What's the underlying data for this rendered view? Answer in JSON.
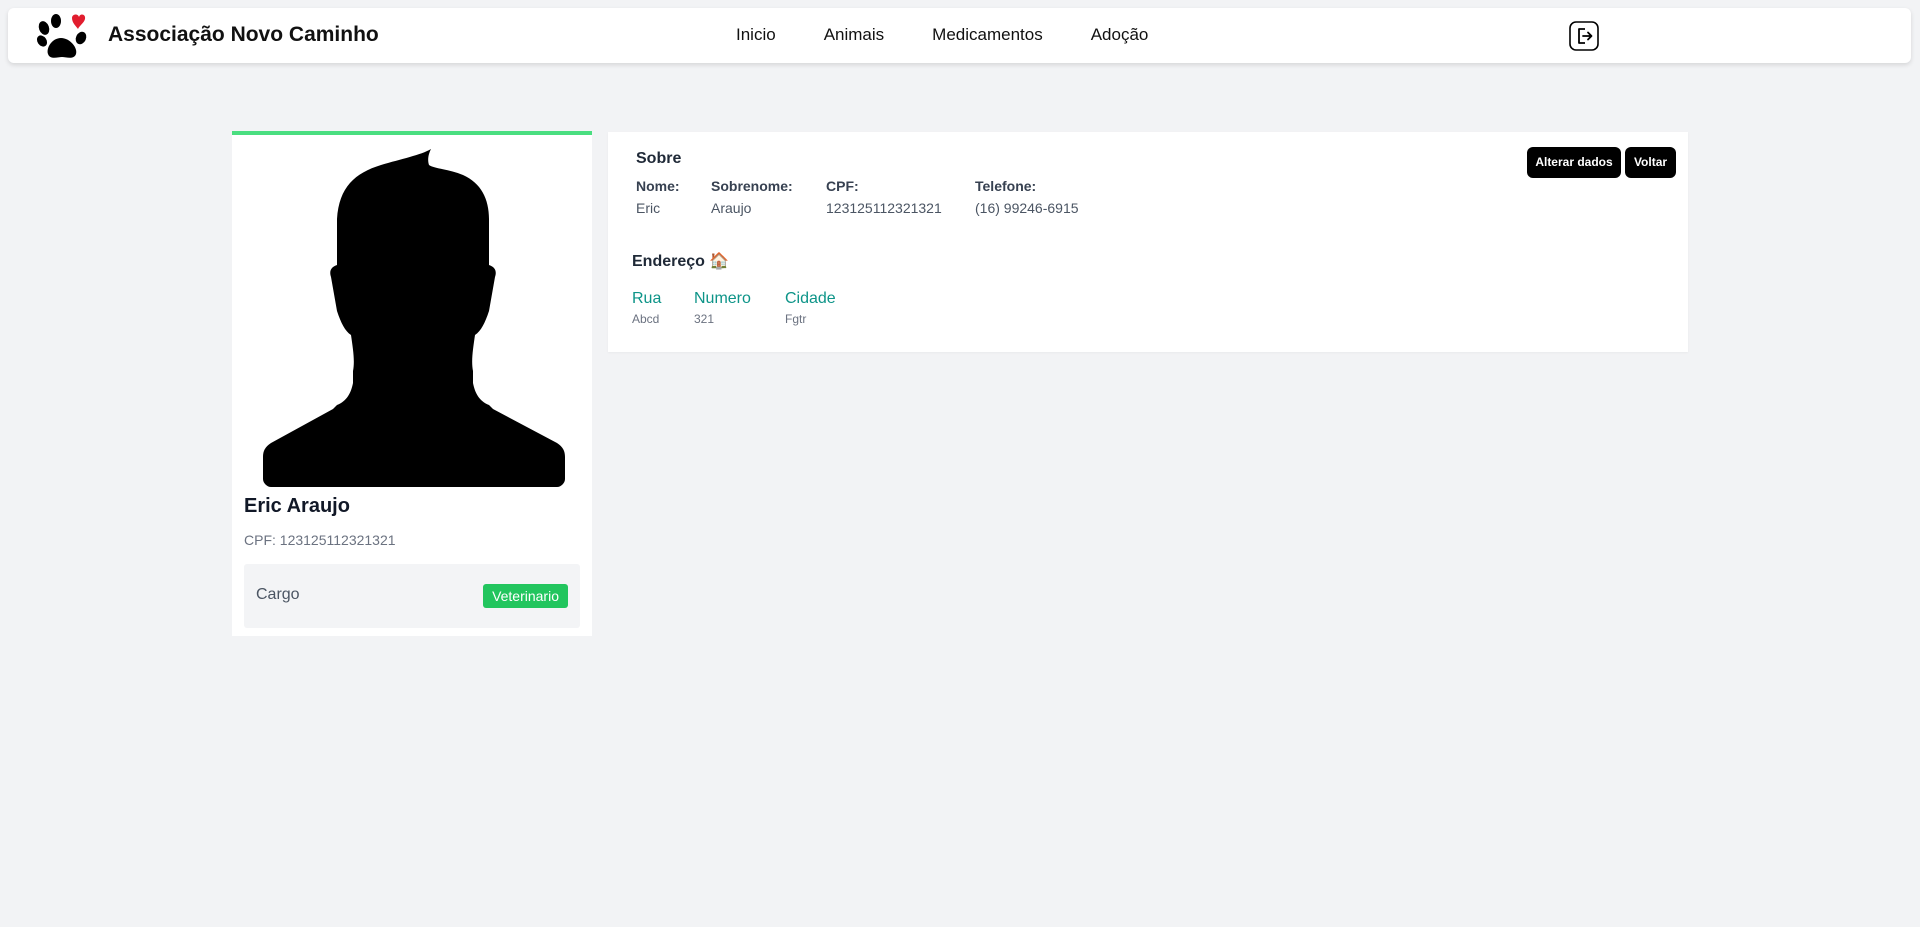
{
  "header": {
    "brand": "Associação Novo Caminho",
    "logo_icon": "paw-heart-icon",
    "nav": [
      "Inicio",
      "Animais",
      "Medicamentos",
      "Adoção"
    ],
    "logout_icon": "logout-icon"
  },
  "profile": {
    "name": "Eric Araujo",
    "cpf_line": "CPF: 123125112321321",
    "role_label": "Cargo",
    "role_value": "Veterinario",
    "accent_color": "#4ade80",
    "badge_color": "#22c55e"
  },
  "about": {
    "title": "Sobre",
    "fields": [
      {
        "label": "Nome:",
        "value": "Eric"
      },
      {
        "label": "Sobrenome:",
        "value": "Araujo"
      },
      {
        "label": "CPF:",
        "value": "123125112321321"
      },
      {
        "label": "Telefone:",
        "value": "(16) 99246-6915"
      }
    ],
    "buttons": {
      "edit": "Alterar dados",
      "back": "Voltar"
    }
  },
  "address": {
    "title": "Endereço 🏠",
    "fields": [
      {
        "label": "Rua",
        "value": "Abcd"
      },
      {
        "label": "Numero",
        "value": "321"
      },
      {
        "label": "Cidade",
        "value": "Fgtr"
      }
    ],
    "label_color": "#0d9488"
  }
}
